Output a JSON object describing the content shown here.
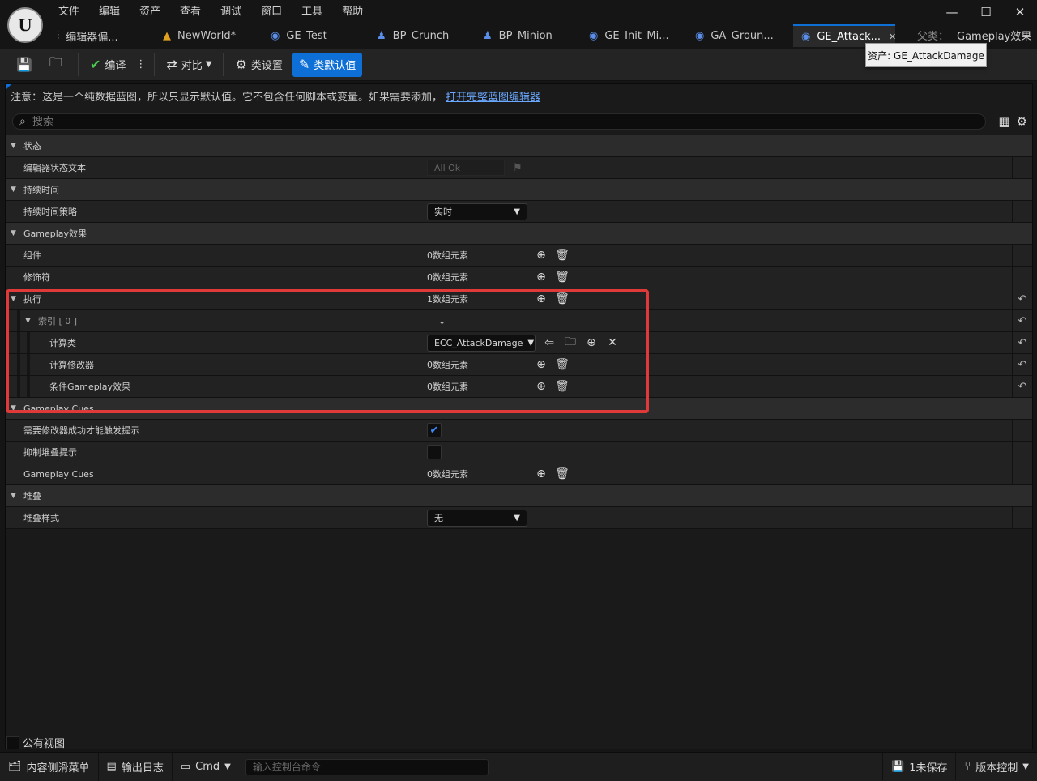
{
  "menu": [
    "文件",
    "编辑",
    "资产",
    "查看",
    "调试",
    "窗口",
    "工具",
    "帮助"
  ],
  "tabs": [
    {
      "label": "编辑器偏...",
      "icon": "settings-sliders-icon"
    },
    {
      "label": "NewWorld*",
      "icon": "level-icon"
    },
    {
      "label": "GE_Test",
      "icon": "blueprint-icon"
    },
    {
      "label": "BP_Crunch",
      "icon": "pawn-icon"
    },
    {
      "label": "BP_Minion",
      "icon": "pawn-icon"
    },
    {
      "label": "GE_Init_Mi...",
      "icon": "blueprint-icon"
    },
    {
      "label": "GA_Groun...",
      "icon": "blueprint-icon"
    },
    {
      "label": "GE_Attack...",
      "icon": "blueprint-icon"
    }
  ],
  "parent": {
    "label": "父类：",
    "value": "Gameplay效果"
  },
  "tooltip": "资产: GE_AttackDamage",
  "toolbar": {
    "compile": "编译",
    "diff": "对比",
    "class_settings": "类设置",
    "class_defaults": "类默认值"
  },
  "notice": {
    "text": "注意：这是一个纯数据蓝图，所以只显示默认值。它不包含任何脚本或变量。如果需要添加，",
    "link": "打开完整蓝图编辑器"
  },
  "search": {
    "placeholder": "搜索"
  },
  "rows": {
    "cat_status": "状态",
    "editor_status_text": "编辑器状态文本",
    "editor_status_value": "All Ok",
    "cat_duration": "持续时间",
    "duration_policy": "持续时间策略",
    "duration_policy_value": "实时",
    "cat_gameplay_effect": "Gameplay效果",
    "components": "组件",
    "components_value": "0数组元素",
    "modifiers": "修饰符",
    "modifiers_value": "0数组元素",
    "executions": "执行",
    "executions_value": "1数组元素",
    "index0": "索引 [ 0 ]",
    "calc_class": "计算类",
    "calc_class_value": "ECC_AttackDamage",
    "calc_modifiers": "计算修改器",
    "calc_modifiers_value": "0数组元素",
    "cond_effects": "条件Gameplay效果",
    "cond_effects_value": "0数组元素",
    "cat_cues": "Gameplay Cues",
    "require_success": "需要修改器成功才能触发提示",
    "suppress_stacking": "抑制堆叠提示",
    "gameplay_cues": "Gameplay Cues",
    "gameplay_cues_value": "0数组元素",
    "cat_stacking": "堆叠",
    "stacking_type": "堆叠样式",
    "stacking_type_value": "无"
  },
  "require_success_checked": true,
  "suppress_stacking_checked": false,
  "public_view": "公有视图",
  "statusbar": {
    "content_drawer": "内容侧滑菜单",
    "output_log": "输出日志",
    "cmd": "Cmd",
    "cmd_placeholder": "输入控制台命令",
    "unsaved": "1未保存",
    "source_control": "版本控制"
  },
  "colors": {
    "accent": "#0e6fd6",
    "highlight": "#e0393a"
  }
}
